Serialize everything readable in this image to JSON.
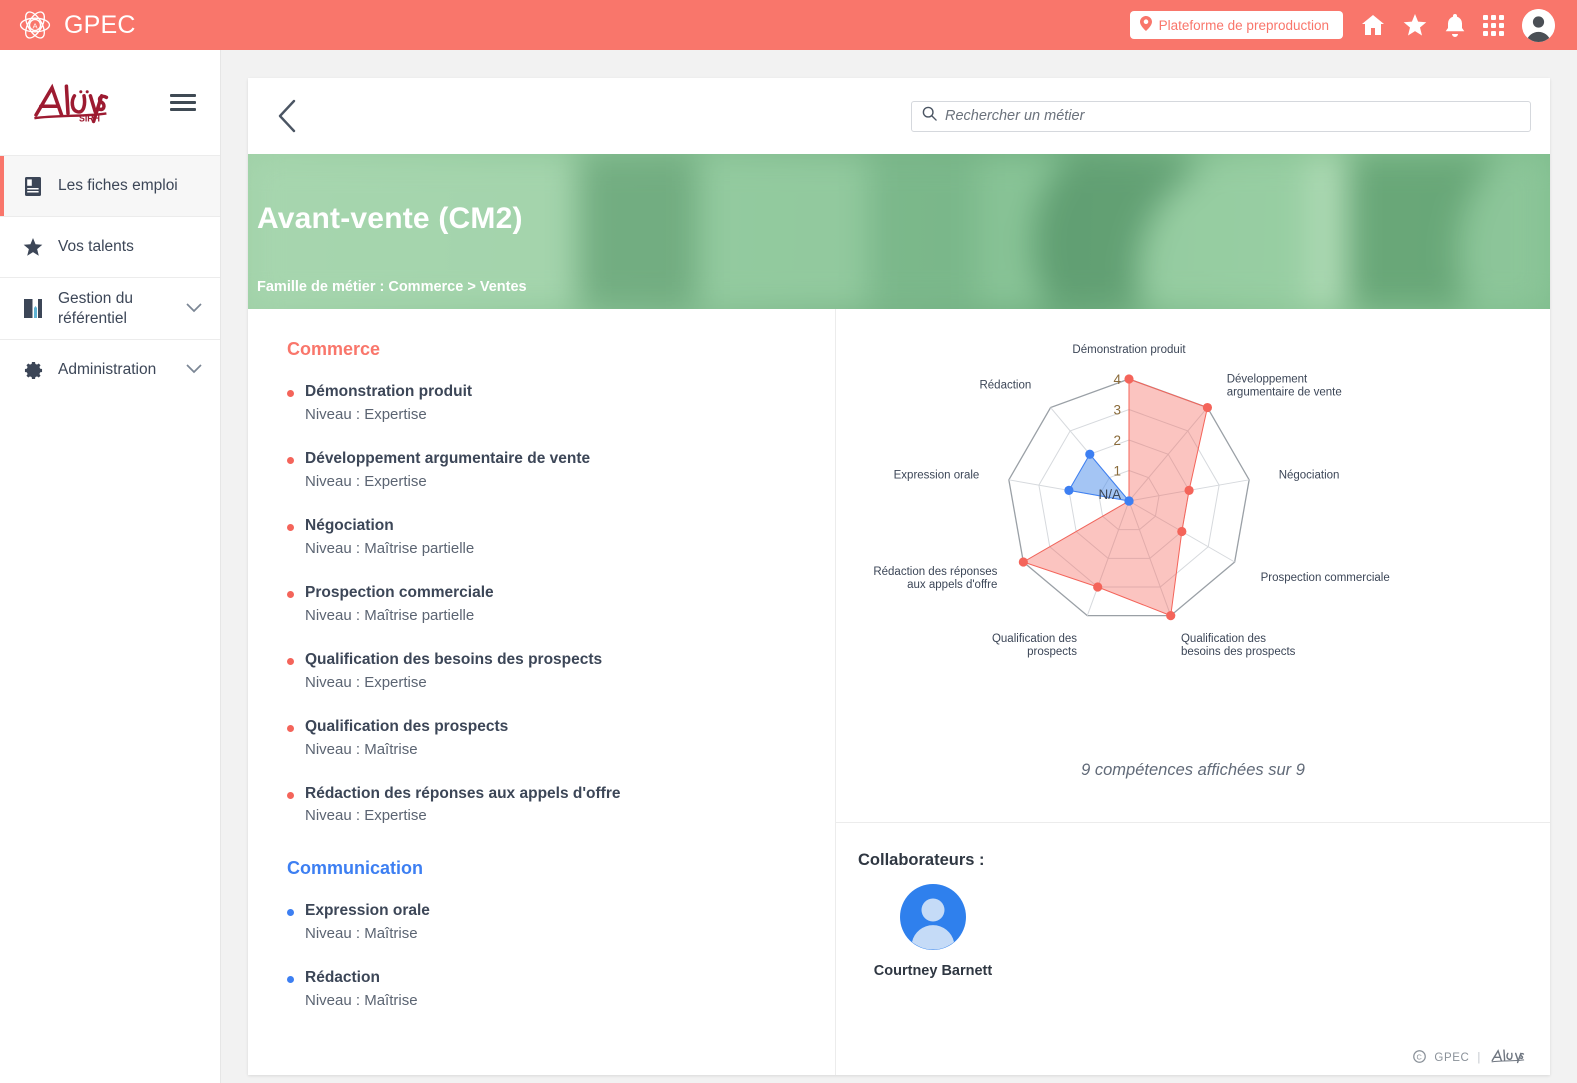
{
  "topbar": {
    "brand": "GPEC",
    "brand_logo_icon": "atom-logo-icon",
    "env_badge": "Plateforme de preproduction",
    "env_badge_icon": "location-pin-icon",
    "icons": [
      "home-icon",
      "star-icon",
      "bell-icon",
      "apps-grid-icon",
      "user-avatar-icon"
    ],
    "accent": "#f9766b"
  },
  "sidebar": {
    "logo_text": "Altays",
    "logo_sub": "SIRH",
    "menu_icon": "hamburger-menu-icon",
    "items": [
      {
        "label": "Les fiches emploi",
        "icon": "document-icon",
        "active": true,
        "expandable": false
      },
      {
        "label": "Vos talents",
        "icon": "star-icon",
        "active": false,
        "expandable": false
      },
      {
        "label": "Gestion du référentiel",
        "icon": "book-icon",
        "active": false,
        "expandable": true
      },
      {
        "label": "Administration",
        "icon": "gear-icon",
        "active": false,
        "expandable": true
      }
    ]
  },
  "toolbar": {
    "back_icon": "chevron-left-icon",
    "search_icon": "search-icon",
    "search_placeholder": "Rechercher un métier",
    "search_value": ""
  },
  "hero": {
    "title": "Avant-vente (CM2)",
    "breadcrumb": "Famille de métier : Commerce > Ventes"
  },
  "skill_groups": [
    {
      "name": "Commerce",
      "color": "#f9766b",
      "skills": [
        {
          "name": "Démonstration produit",
          "level": "Niveau : Expertise"
        },
        {
          "name": "Développement argumentaire de vente",
          "level": "Niveau : Expertise"
        },
        {
          "name": "Négociation",
          "level": "Niveau : Maîtrise partielle"
        },
        {
          "name": "Prospection commerciale",
          "level": "Niveau : Maîtrise partielle"
        },
        {
          "name": "Qualification des besoins des prospects",
          "level": "Niveau : Expertise"
        },
        {
          "name": "Qualification des prospects",
          "level": "Niveau : Maîtrise"
        },
        {
          "name": "Rédaction des réponses aux appels d'offre",
          "level": "Niveau : Expertise"
        }
      ]
    },
    {
      "name": "Communication",
      "color": "#3d7ff2",
      "skills": [
        {
          "name": "Expression orale",
          "level": "Niveau : Maîtrise"
        },
        {
          "name": "Rédaction",
          "level": "Niveau : Maîtrise"
        }
      ]
    }
  ],
  "chart_data": {
    "type": "radar",
    "title": "",
    "caption": "9 compétences affichées sur 9",
    "axes": [
      "Démonstration produit",
      "Développement argumentaire de vente",
      "Négociation",
      "Prospection commerciale",
      "Qualification des besoins des prospects",
      "Qualification des prospects",
      "Rédaction des réponses aux appels d'offre",
      "Expression orale",
      "Rédaction"
    ],
    "tick_labels": [
      "N/A",
      "1",
      "2",
      "3",
      "4"
    ],
    "rlim": [
      0,
      4
    ],
    "grid": true,
    "legend": "none",
    "series": [
      {
        "name": "Commerce",
        "color": "#f4645a",
        "fill": "rgba(244,100,90,0.38)",
        "values": [
          4,
          4,
          2,
          2,
          4,
          3,
          4,
          null,
          null
        ]
      },
      {
        "name": "Communication",
        "color": "#3d7ff2",
        "fill": "rgba(90,150,235,0.55)",
        "values": [
          null,
          null,
          null,
          null,
          null,
          null,
          null,
          2,
          2
        ]
      }
    ]
  },
  "collaborators": {
    "title": "Collaborateurs :",
    "people": [
      {
        "name": "Courtney Barnett",
        "avatar_icon": "user-avatar-icon"
      }
    ]
  },
  "footer": {
    "copyright_icon": "copyright-icon",
    "product": "GPEC",
    "separator": "|",
    "company": "Altays"
  }
}
